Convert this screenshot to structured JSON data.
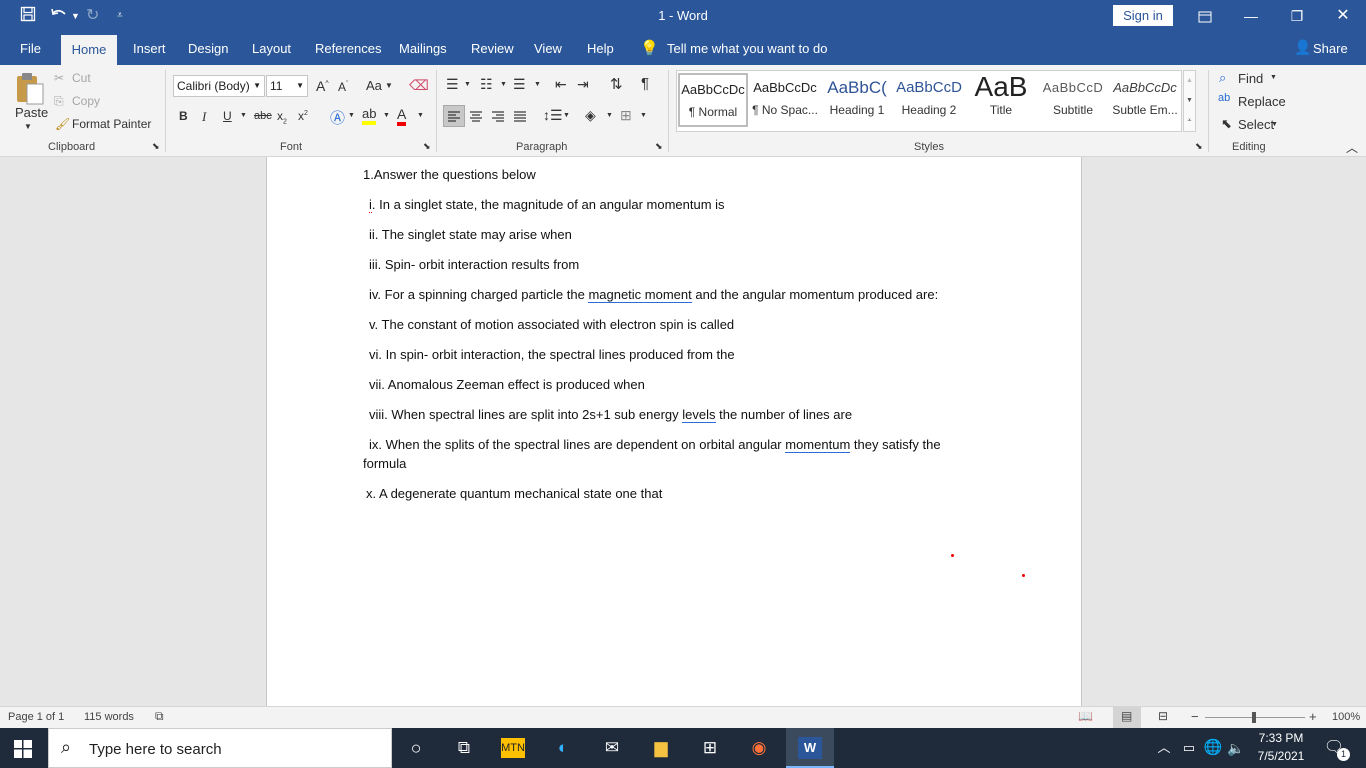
{
  "titlebar": {
    "title": "1  -  Word",
    "sign_in": "Sign in"
  },
  "menu": {
    "file": "File",
    "home": "Home",
    "insert": "Insert",
    "design": "Design",
    "layout": "Layout",
    "references": "References",
    "mailings": "Mailings",
    "review": "Review",
    "view": "View",
    "help": "Help",
    "tell_me": "Tell me what you want to do",
    "share": "Share"
  },
  "clipboard": {
    "paste": "Paste",
    "cut": "Cut",
    "copy": "Copy",
    "format_painter": "Format Painter",
    "label": "Clipboard"
  },
  "font": {
    "name": "Calibri (Body)",
    "size": "11",
    "case": "Aa",
    "label": "Font"
  },
  "paragraph": {
    "label": "Paragraph"
  },
  "styles": {
    "items": [
      {
        "preview": "AaBbCcDc",
        "name": "¶ Normal"
      },
      {
        "preview": "AaBbCcDc",
        "name": "¶ No Spac..."
      },
      {
        "preview": "AaBbC(",
        "name": "Heading 1"
      },
      {
        "preview": "AaBbCcD",
        "name": "Heading 2"
      },
      {
        "preview": "AaB",
        "name": "Title"
      },
      {
        "preview": "AaBbCcD",
        "name": "Subtitle"
      },
      {
        "preview": "AaBbCcDc",
        "name": "Subtle Em..."
      }
    ],
    "label": "Styles"
  },
  "editing": {
    "find": "Find",
    "replace": "Replace",
    "select": "Select",
    "label": "Editing"
  },
  "document": {
    "heading": "1.Answer the questions below",
    "q1": {
      "num": "i",
      "text": ". In a singlet state, the magnitude of an angular momentum is"
    },
    "q2": "ii. The singlet state may arise when",
    "q3": "iii. Spin- orbit interaction results from",
    "q4": {
      "pre": "iv. For a spinning charged particle the ",
      "link": "magnetic  moment",
      "post": " and the angular momentum produced are:"
    },
    "q5": "v. The constant of motion associated with electron spin is called",
    "q6": "vi. In spin- orbit interaction, the spectral lines produced from the",
    "q7": "vii. Anomalous Zeeman effect is produced when",
    "q8": {
      "pre": "viii. When spectral lines are split into 2s+1 sub energy ",
      "link": "levels",
      "post": " the number of lines are"
    },
    "q9": {
      "pre": "ix. When the splits of the spectral lines are dependent on orbital angular ",
      "link": "momentum",
      "post": " they satisfy the",
      "cont": "formula"
    },
    "q10": "x. A degenerate quantum mechanical state one that"
  },
  "status": {
    "page": "Page 1 of 1",
    "words": "115 words",
    "zoom": "100%"
  },
  "taskbar": {
    "search": "Type here to search",
    "time": "7:33 PM",
    "date": "7/5/2021",
    "notifications": "1"
  }
}
